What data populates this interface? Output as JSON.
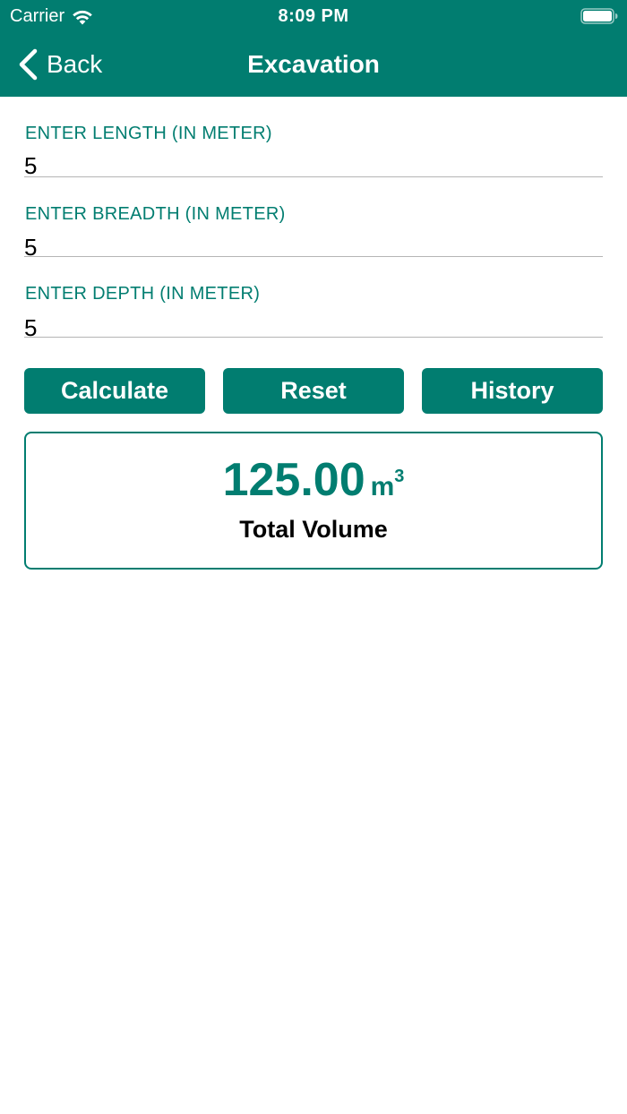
{
  "status_bar": {
    "carrier": "Carrier",
    "time": "8:09 PM"
  },
  "nav": {
    "back_label": "Back",
    "title": "Excavation"
  },
  "fields": [
    {
      "label": "ENTER LENGTH (IN METER)",
      "value": "5"
    },
    {
      "label": "ENTER BREADTH (IN METER)",
      "value": "5"
    },
    {
      "label": "ENTER DEPTH (IN METER)",
      "value": "5"
    }
  ],
  "buttons": {
    "calculate": "Calculate",
    "reset": "Reset",
    "history": "History"
  },
  "result": {
    "value": "125.00",
    "unit": "m",
    "unit_superscript": "3",
    "label": "Total Volume"
  },
  "colors": {
    "primary": "#017d70",
    "background": "#ffffff",
    "divider": "#b5b5b5"
  }
}
